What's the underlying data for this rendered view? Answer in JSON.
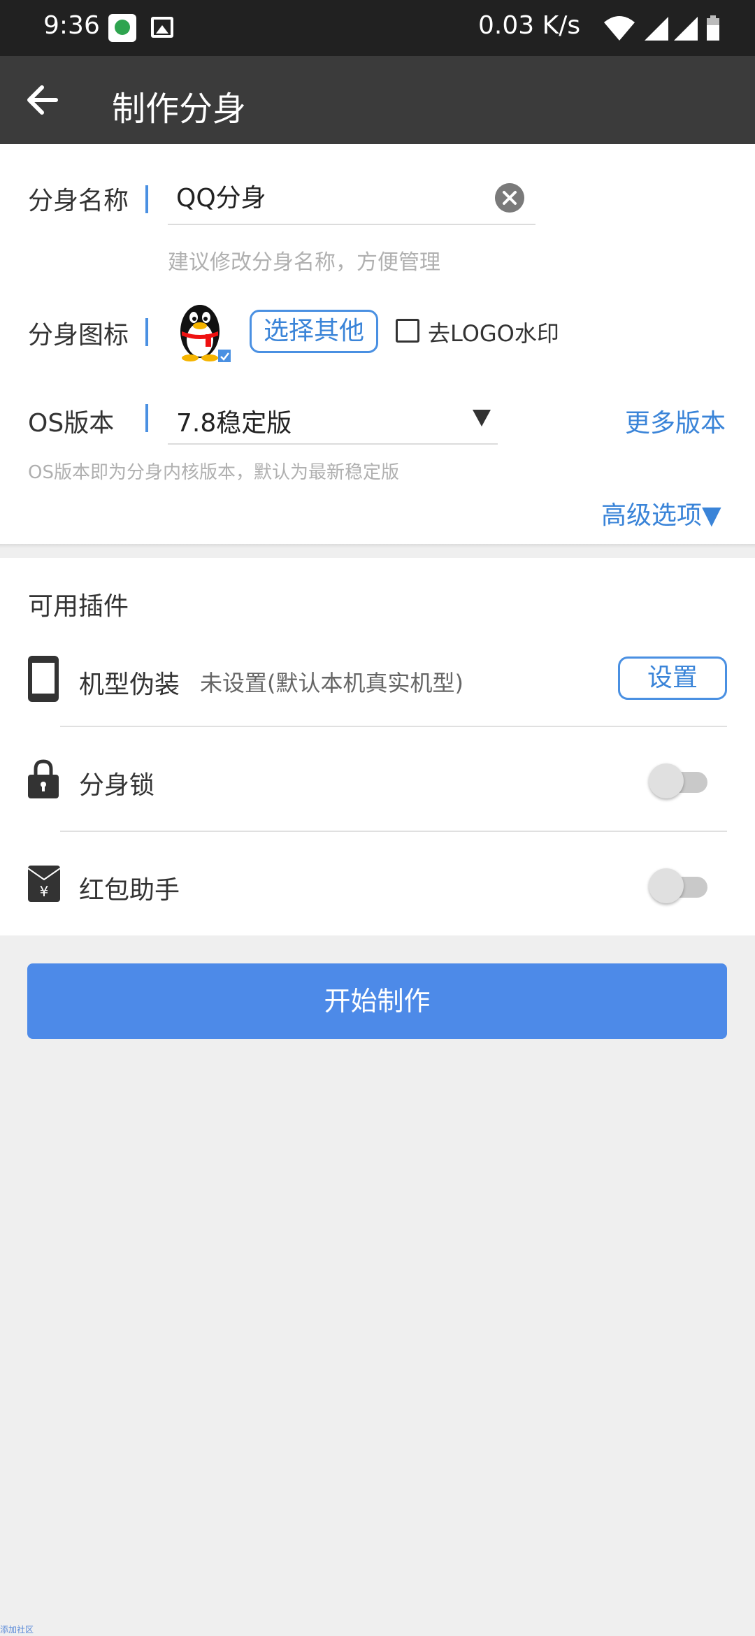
{
  "status_bar": {
    "time": "9:36",
    "speed": "0.03 K/s",
    "icons": [
      "app-notification-icon",
      "image-icon",
      "wifi-icon",
      "signal-icon",
      "signal-icon",
      "battery-icon"
    ]
  },
  "app_bar": {
    "title": "制作分身",
    "back_icon": "arrow-left-icon"
  },
  "form": {
    "name_label": "分身名称",
    "name_value": "QQ分身",
    "name_hint": "建议修改分身名称，方便管理",
    "icon_label": "分身图标",
    "choose_other_label": "选择其他",
    "remove_logo_label": "去LOGO水印",
    "remove_logo_checked": false,
    "os_label": "OS版本",
    "os_value": "7.8稳定版",
    "more_versions_label": "更多版本",
    "os_hint": "OS版本即为分身内核版本，默认为最新稳定版",
    "advanced_label": "高级选项▼"
  },
  "plugins": {
    "section_title": "可用插件",
    "items": [
      {
        "label": "机型伪装",
        "sub": "未设置(默认本机真实机型)",
        "action": "设置",
        "icon": "phone-icon"
      },
      {
        "label": "分身锁",
        "toggle": false,
        "icon": "lock-icon"
      },
      {
        "label": "红包助手",
        "toggle": false,
        "icon": "red-envelope-icon"
      }
    ]
  },
  "primary_button": "开始制作",
  "watermark": "添加社区",
  "colors": {
    "accent": "#4a90e2",
    "primary_button": "#4d8ae8",
    "app_bar": "#3b3b3b",
    "status_bar": "#212121"
  }
}
